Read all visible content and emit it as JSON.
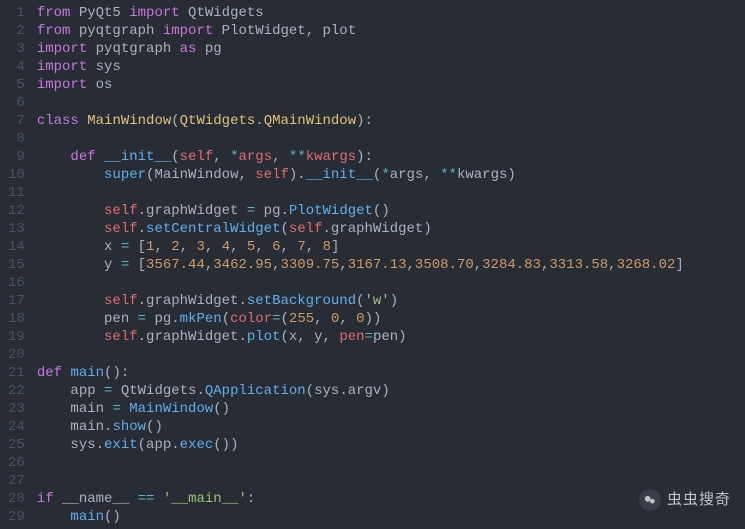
{
  "lineNumbers": [
    "1",
    "2",
    "3",
    "4",
    "5",
    "6",
    "7",
    "8",
    "9",
    "10",
    "11",
    "12",
    "13",
    "14",
    "15",
    "16",
    "17",
    "18",
    "19",
    "20",
    "21",
    "22",
    "23",
    "24",
    "25",
    "26",
    "27",
    "28",
    "29"
  ],
  "lines": [
    [
      {
        "c": "kw",
        "t": "from"
      },
      {
        "c": "id",
        "t": " PyQt5 "
      },
      {
        "c": "kw",
        "t": "import"
      },
      {
        "c": "id",
        "t": " QtWidgets"
      }
    ],
    [
      {
        "c": "kw",
        "t": "from"
      },
      {
        "c": "id",
        "t": " pyqtgraph "
      },
      {
        "c": "kw",
        "t": "import"
      },
      {
        "c": "id",
        "t": " PlotWidget"
      },
      {
        "c": "punct",
        "t": ", "
      },
      {
        "c": "id",
        "t": "plot"
      }
    ],
    [
      {
        "c": "kw",
        "t": "import"
      },
      {
        "c": "id",
        "t": " pyqtgraph "
      },
      {
        "c": "kw",
        "t": "as"
      },
      {
        "c": "id",
        "t": " pg"
      }
    ],
    [
      {
        "c": "kw",
        "t": "import"
      },
      {
        "c": "id",
        "t": " sys"
      }
    ],
    [
      {
        "c": "kw",
        "t": "import"
      },
      {
        "c": "id",
        "t": " os"
      }
    ],
    [],
    [
      {
        "c": "kw",
        "t": "class"
      },
      {
        "c": "id",
        "t": " "
      },
      {
        "c": "cls",
        "t": "MainWindow"
      },
      {
        "c": "punct",
        "t": "("
      },
      {
        "c": "cls2",
        "t": "QtWidgets"
      },
      {
        "c": "punct",
        "t": "."
      },
      {
        "c": "cls2",
        "t": "QMainWindow"
      },
      {
        "c": "punct",
        "t": "):"
      }
    ],
    [],
    [
      {
        "c": "id",
        "t": "    "
      },
      {
        "c": "kw",
        "t": "def"
      },
      {
        "c": "id",
        "t": " "
      },
      {
        "c": "fnname",
        "t": "__init__"
      },
      {
        "c": "punct",
        "t": "("
      },
      {
        "c": "self",
        "t": "self"
      },
      {
        "c": "punct",
        "t": ", "
      },
      {
        "c": "op",
        "t": "*"
      },
      {
        "c": "param",
        "t": "args"
      },
      {
        "c": "punct",
        "t": ", "
      },
      {
        "c": "op",
        "t": "**"
      },
      {
        "c": "param",
        "t": "kwargs"
      },
      {
        "c": "punct",
        "t": "):"
      }
    ],
    [
      {
        "c": "id",
        "t": "        "
      },
      {
        "c": "fn",
        "t": "super"
      },
      {
        "c": "punct",
        "t": "("
      },
      {
        "c": "id",
        "t": "MainWindow"
      },
      {
        "c": "punct",
        "t": ", "
      },
      {
        "c": "self",
        "t": "self"
      },
      {
        "c": "punct",
        "t": ")."
      },
      {
        "c": "fn",
        "t": "__init__"
      },
      {
        "c": "punct",
        "t": "("
      },
      {
        "c": "op",
        "t": "*"
      },
      {
        "c": "id",
        "t": "args"
      },
      {
        "c": "punct",
        "t": ", "
      },
      {
        "c": "op",
        "t": "**"
      },
      {
        "c": "id",
        "t": "kwargs"
      },
      {
        "c": "punct",
        "t": ")"
      }
    ],
    [],
    [
      {
        "c": "id",
        "t": "        "
      },
      {
        "c": "self",
        "t": "self"
      },
      {
        "c": "punct",
        "t": "."
      },
      {
        "c": "id",
        "t": "graphWidget "
      },
      {
        "c": "op",
        "t": "="
      },
      {
        "c": "id",
        "t": " pg"
      },
      {
        "c": "punct",
        "t": "."
      },
      {
        "c": "fn",
        "t": "PlotWidget"
      },
      {
        "c": "punct",
        "t": "()"
      }
    ],
    [
      {
        "c": "id",
        "t": "        "
      },
      {
        "c": "self",
        "t": "self"
      },
      {
        "c": "punct",
        "t": "."
      },
      {
        "c": "fn",
        "t": "setCentralWidget"
      },
      {
        "c": "punct",
        "t": "("
      },
      {
        "c": "self",
        "t": "self"
      },
      {
        "c": "punct",
        "t": "."
      },
      {
        "c": "id",
        "t": "graphWidget"
      },
      {
        "c": "punct",
        "t": ")"
      }
    ],
    [
      {
        "c": "id",
        "t": "        x "
      },
      {
        "c": "op",
        "t": "="
      },
      {
        "c": "punct",
        "t": " ["
      },
      {
        "c": "num",
        "t": "1"
      },
      {
        "c": "punct",
        "t": ", "
      },
      {
        "c": "num",
        "t": "2"
      },
      {
        "c": "punct",
        "t": ", "
      },
      {
        "c": "num",
        "t": "3"
      },
      {
        "c": "punct",
        "t": ", "
      },
      {
        "c": "num",
        "t": "4"
      },
      {
        "c": "punct",
        "t": ", "
      },
      {
        "c": "num",
        "t": "5"
      },
      {
        "c": "punct",
        "t": ", "
      },
      {
        "c": "num",
        "t": "6"
      },
      {
        "c": "punct",
        "t": ", "
      },
      {
        "c": "num",
        "t": "7"
      },
      {
        "c": "punct",
        "t": ", "
      },
      {
        "c": "num",
        "t": "8"
      },
      {
        "c": "punct",
        "t": "]"
      }
    ],
    [
      {
        "c": "id",
        "t": "        y "
      },
      {
        "c": "op",
        "t": "="
      },
      {
        "c": "punct",
        "t": " ["
      },
      {
        "c": "num",
        "t": "3567.44"
      },
      {
        "c": "punct",
        "t": ","
      },
      {
        "c": "num",
        "t": "3462.95"
      },
      {
        "c": "punct",
        "t": ","
      },
      {
        "c": "num",
        "t": "3309.75"
      },
      {
        "c": "punct",
        "t": ","
      },
      {
        "c": "num",
        "t": "3167.13"
      },
      {
        "c": "punct",
        "t": ","
      },
      {
        "c": "num",
        "t": "3508.70"
      },
      {
        "c": "punct",
        "t": ","
      },
      {
        "c": "num",
        "t": "3284.83"
      },
      {
        "c": "punct",
        "t": ","
      },
      {
        "c": "num",
        "t": "3313.58"
      },
      {
        "c": "punct",
        "t": ","
      },
      {
        "c": "num",
        "t": "3268.02"
      },
      {
        "c": "punct",
        "t": "]"
      }
    ],
    [],
    [
      {
        "c": "id",
        "t": "        "
      },
      {
        "c": "self",
        "t": "self"
      },
      {
        "c": "punct",
        "t": "."
      },
      {
        "c": "id",
        "t": "graphWidget"
      },
      {
        "c": "punct",
        "t": "."
      },
      {
        "c": "fn",
        "t": "setBackground"
      },
      {
        "c": "punct",
        "t": "("
      },
      {
        "c": "str",
        "t": "'w'"
      },
      {
        "c": "punct",
        "t": ")"
      }
    ],
    [
      {
        "c": "id",
        "t": "        pen "
      },
      {
        "c": "op",
        "t": "="
      },
      {
        "c": "id",
        "t": " pg"
      },
      {
        "c": "punct",
        "t": "."
      },
      {
        "c": "fn",
        "t": "mkPen"
      },
      {
        "c": "punct",
        "t": "("
      },
      {
        "c": "param",
        "t": "color"
      },
      {
        "c": "op",
        "t": "="
      },
      {
        "c": "punct",
        "t": "("
      },
      {
        "c": "num",
        "t": "255"
      },
      {
        "c": "punct",
        "t": ", "
      },
      {
        "c": "num",
        "t": "0"
      },
      {
        "c": "punct",
        "t": ", "
      },
      {
        "c": "num",
        "t": "0"
      },
      {
        "c": "punct",
        "t": "))"
      }
    ],
    [
      {
        "c": "id",
        "t": "        "
      },
      {
        "c": "self",
        "t": "self"
      },
      {
        "c": "punct",
        "t": "."
      },
      {
        "c": "id",
        "t": "graphWidget"
      },
      {
        "c": "punct",
        "t": "."
      },
      {
        "c": "fn",
        "t": "plot"
      },
      {
        "c": "punct",
        "t": "("
      },
      {
        "c": "id",
        "t": "x"
      },
      {
        "c": "punct",
        "t": ", "
      },
      {
        "c": "id",
        "t": "y"
      },
      {
        "c": "punct",
        "t": ", "
      },
      {
        "c": "param",
        "t": "pen"
      },
      {
        "c": "op",
        "t": "="
      },
      {
        "c": "id",
        "t": "pen"
      },
      {
        "c": "punct",
        "t": ")"
      }
    ],
    [],
    [
      {
        "c": "kw",
        "t": "def"
      },
      {
        "c": "id",
        "t": " "
      },
      {
        "c": "fnname",
        "t": "main"
      },
      {
        "c": "punct",
        "t": "():"
      }
    ],
    [
      {
        "c": "id",
        "t": "    app "
      },
      {
        "c": "op",
        "t": "="
      },
      {
        "c": "id",
        "t": " QtWidgets"
      },
      {
        "c": "punct",
        "t": "."
      },
      {
        "c": "fn",
        "t": "QApplication"
      },
      {
        "c": "punct",
        "t": "("
      },
      {
        "c": "id",
        "t": "sys"
      },
      {
        "c": "punct",
        "t": "."
      },
      {
        "c": "id",
        "t": "argv"
      },
      {
        "c": "punct",
        "t": ")"
      }
    ],
    [
      {
        "c": "id",
        "t": "    main "
      },
      {
        "c": "op",
        "t": "="
      },
      {
        "c": "id",
        "t": " "
      },
      {
        "c": "fn",
        "t": "MainWindow"
      },
      {
        "c": "punct",
        "t": "()"
      }
    ],
    [
      {
        "c": "id",
        "t": "    main"
      },
      {
        "c": "punct",
        "t": "."
      },
      {
        "c": "fn",
        "t": "show"
      },
      {
        "c": "punct",
        "t": "()"
      }
    ],
    [
      {
        "c": "id",
        "t": "    sys"
      },
      {
        "c": "punct",
        "t": "."
      },
      {
        "c": "fn",
        "t": "exit"
      },
      {
        "c": "punct",
        "t": "("
      },
      {
        "c": "id",
        "t": "app"
      },
      {
        "c": "punct",
        "t": "."
      },
      {
        "c": "fn",
        "t": "exec"
      },
      {
        "c": "punct",
        "t": "())"
      }
    ],
    [],
    [],
    [
      {
        "c": "kw",
        "t": "if"
      },
      {
        "c": "id",
        "t": " __name__ "
      },
      {
        "c": "op",
        "t": "=="
      },
      {
        "c": "id",
        "t": " "
      },
      {
        "c": "str",
        "t": "'__main__'"
      },
      {
        "c": "punct",
        "t": ":"
      }
    ],
    [
      {
        "c": "id",
        "t": "    "
      },
      {
        "c": "fn",
        "t": "main"
      },
      {
        "c": "punct",
        "t": "()"
      }
    ]
  ],
  "watermark": {
    "text": "虫虫搜奇",
    "icon": "wechat"
  }
}
